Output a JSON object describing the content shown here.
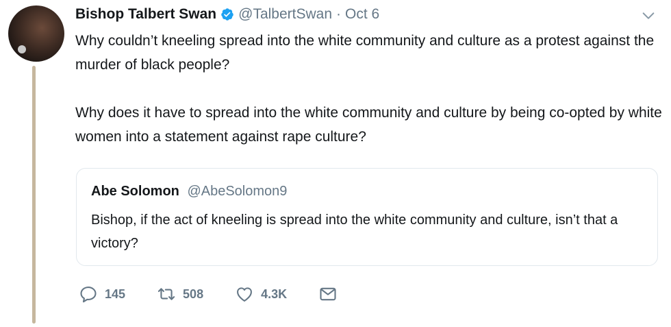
{
  "author": {
    "name": "Bishop Talbert Swan",
    "handle": "@TalbertSwan",
    "separator": "·",
    "date": "Oct 6"
  },
  "tweet": {
    "paragraphs": [
      "Why couldn’t kneeling spread into the white community and culture as a protest against the murder of black people?",
      "Why does it have to spread into the white community and culture by being co-opted by white women into a statement against rape culture?"
    ]
  },
  "quoted_tweet": {
    "name": "Abe Solomon",
    "handle": "@AbeSolomon9",
    "text": "Bishop, if the act of kneeling is spread into the white community and culture, isn’t that a victory?"
  },
  "actions": {
    "replies": "145",
    "retweets": "508",
    "likes": "4.3K"
  },
  "colors": {
    "text": "#14171a",
    "secondary": "#657786",
    "verified": "#1da1f2",
    "border": "#e1e8ed",
    "thread_line": "#c6b79e"
  },
  "icons": [
    "verified-badge-icon",
    "chevron-down-icon",
    "reply-icon",
    "retweet-icon",
    "like-icon",
    "message-icon"
  ]
}
